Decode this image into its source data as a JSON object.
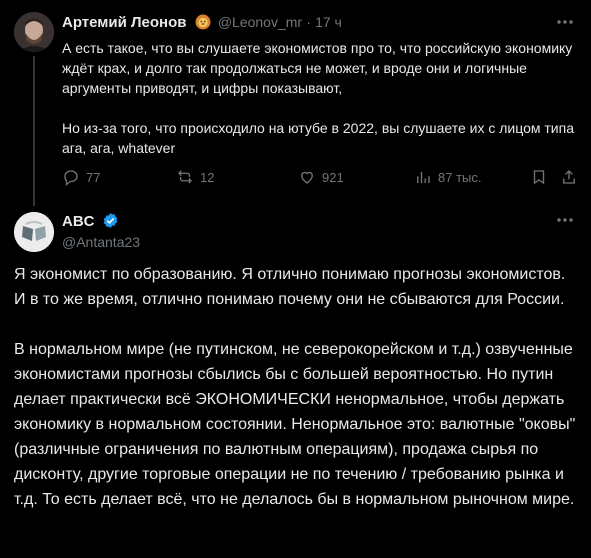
{
  "tweet1": {
    "author_name": "Артемий Леонов",
    "emoji": "lion-emoji",
    "handle": "@Leonov_mr",
    "separator": "·",
    "time": "17 ч",
    "paragraphs": [
      "А есть такое, что вы слушаете экономистов про то, что российскую экономику ждёт крах, и долго так продолжаться не может, и вроде они и логичные аргументы приводят, и цифры показывают,",
      "Но из-за того, что происходило на ютубе в 2022, вы слушаете их с лицом типа ага, ага, whatever"
    ],
    "actions": {
      "replies": "77",
      "reposts": "12",
      "likes": "921",
      "views": "87 тыс."
    }
  },
  "tweet2": {
    "author_name": "ABC",
    "handle": "@Antanta23",
    "verified": true,
    "paragraphs": [
      "Я экономист по образованию. Я отлично понимаю прогнозы экономистов. И в то же время, отлично понимаю почему они не сбываются для России.",
      "В нормальном мире (не путинском, не северокорейском и т.д.) озвученные экономистами прогнозы сбылись бы с большей вероятностью. Но путин делает практически всё ЭКОНОМИЧЕСКИ ненормальное, чтобы держать экономику в нормальном состоянии. Ненормальное это: валютные \"оковы\" (различные ограничения по валютным операциям), продажа сырья по дисконту, другие торговые операции не по течению / требованию рынка и т.д. То есть делает всё, что не делалось бы в нормальном рыночном мире."
    ]
  },
  "colors": {
    "background": "#000000",
    "text": "#e7e9ea",
    "muted": "#71767b",
    "verified": "#1d9bf0",
    "thread_line": "#333639"
  }
}
